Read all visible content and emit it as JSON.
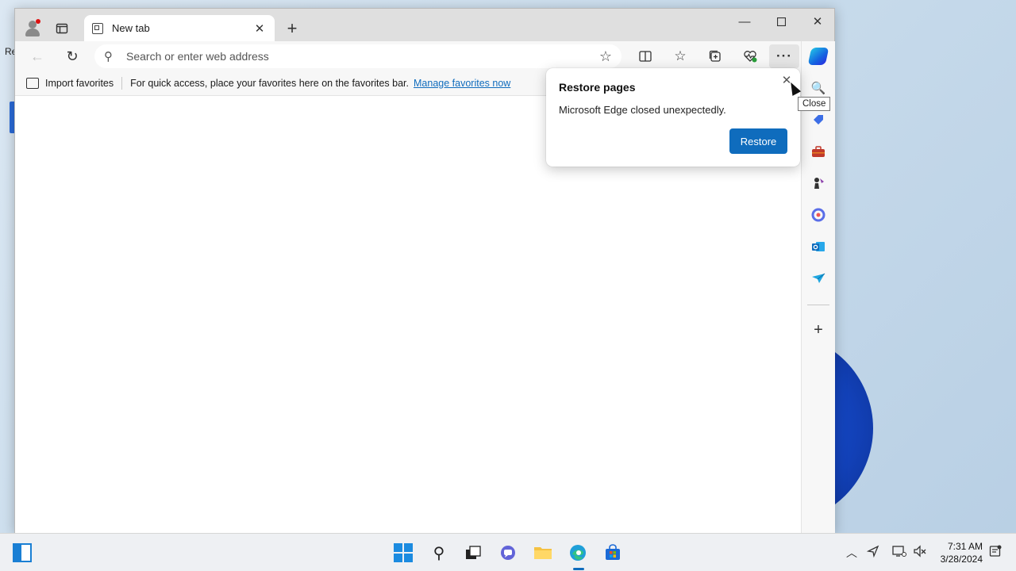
{
  "desktop": {
    "fragment_text": "Re"
  },
  "browser": {
    "tab": {
      "title": "New tab"
    },
    "address_bar": {
      "placeholder": "Search or enter web address"
    },
    "favorites_bar": {
      "import_label": "Import favorites",
      "message": "For quick access, place your favorites here on the favorites bar.",
      "manage_link": "Manage favorites now"
    },
    "sidebar": {
      "icons": [
        "copilot-icon",
        "search-icon",
        "shopping-icon",
        "tools-icon",
        "games-icon",
        "microsoft365-icon",
        "outlook-icon",
        "drop-icon",
        "add-icon"
      ]
    }
  },
  "popup": {
    "title": "Restore pages",
    "message": "Microsoft Edge closed unexpectedly.",
    "restore_label": "Restore",
    "tooltip": "Close"
  },
  "taskbar": {
    "time": "7:31 AM",
    "date": "3/28/2024"
  },
  "colors": {
    "accent": "#0f6cbd",
    "titlebar": "#dfdfdf",
    "toolbar": "#f7f7f7"
  }
}
